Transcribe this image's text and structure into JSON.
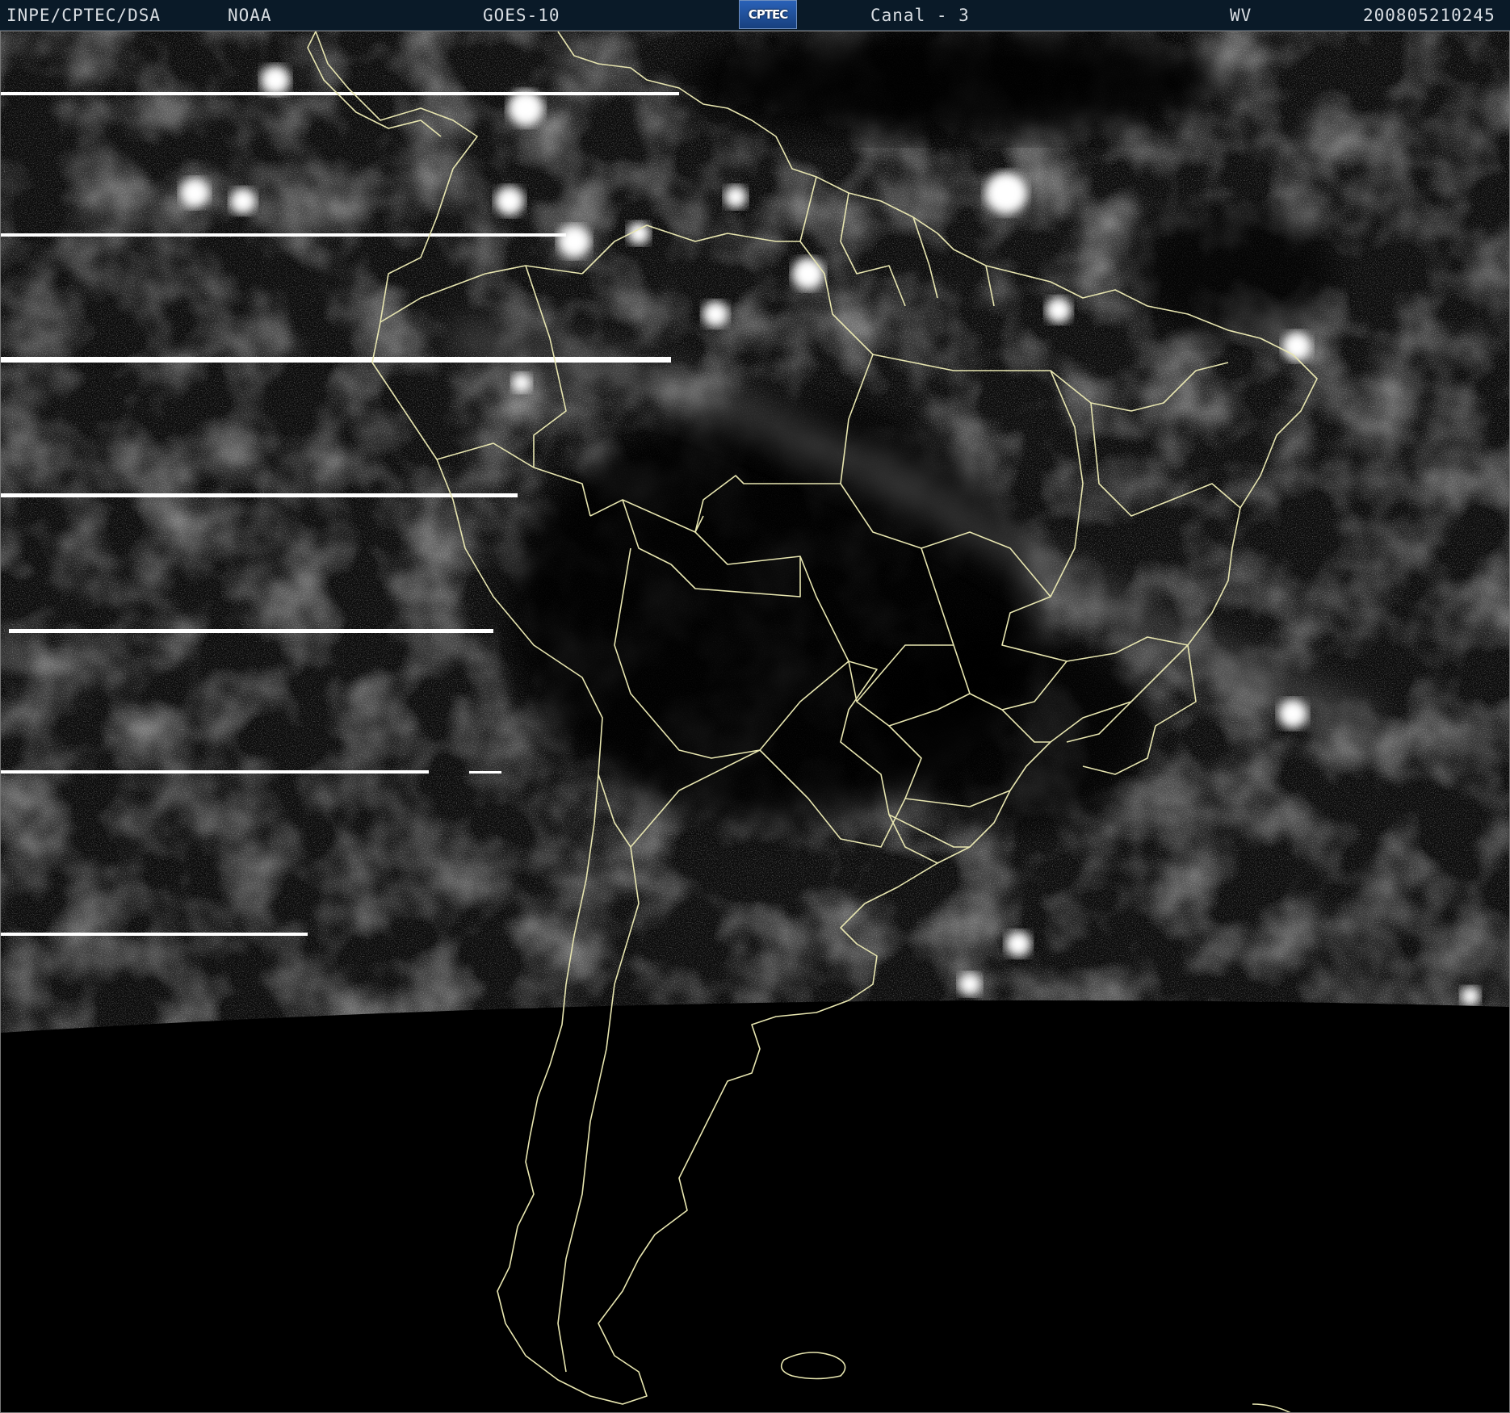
{
  "header": {
    "agency": "INPE/CPTEC/DSA",
    "operator": "NOAA",
    "satellite": "GOES-10",
    "logo_text": "CPTEC",
    "channel": "Canal - 3",
    "band": "WV",
    "timestamp": "200805210245"
  },
  "colors": {
    "header_bg": "#0a1a28",
    "header_text": "#d8dde2",
    "border_lines": "#e8e6b0",
    "cloud_bright": "#ffffff",
    "background": "#000000"
  }
}
